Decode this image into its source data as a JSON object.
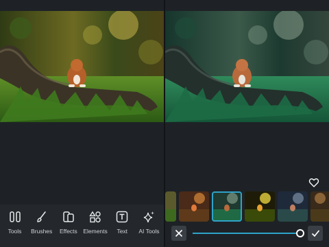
{
  "toolbar": {
    "items": [
      {
        "label": "Tools",
        "icon": "tools-icon"
      },
      {
        "label": "Brushes",
        "icon": "brush-icon"
      },
      {
        "label": "Effects",
        "icon": "effects-icon"
      },
      {
        "label": "Elements",
        "icon": "elements-icon"
      },
      {
        "label": "Text",
        "icon": "text-icon"
      },
      {
        "label": "AI Tools",
        "icon": "ai-sparkle-icon"
      }
    ]
  },
  "effects_panel": {
    "favorite_icon": "heart-icon",
    "filter_thumbnails": [
      "partial",
      "warm",
      "teal",
      "golden",
      "cool",
      "partial-warm"
    ],
    "selected_filter_index": 2,
    "intensity": 1.0,
    "cancel_icon": "close-icon",
    "apply_icon": "check-icon"
  },
  "colors": {
    "accent": "#2ea3c9",
    "background": "#1e2226",
    "toolbar": "#24282c"
  }
}
